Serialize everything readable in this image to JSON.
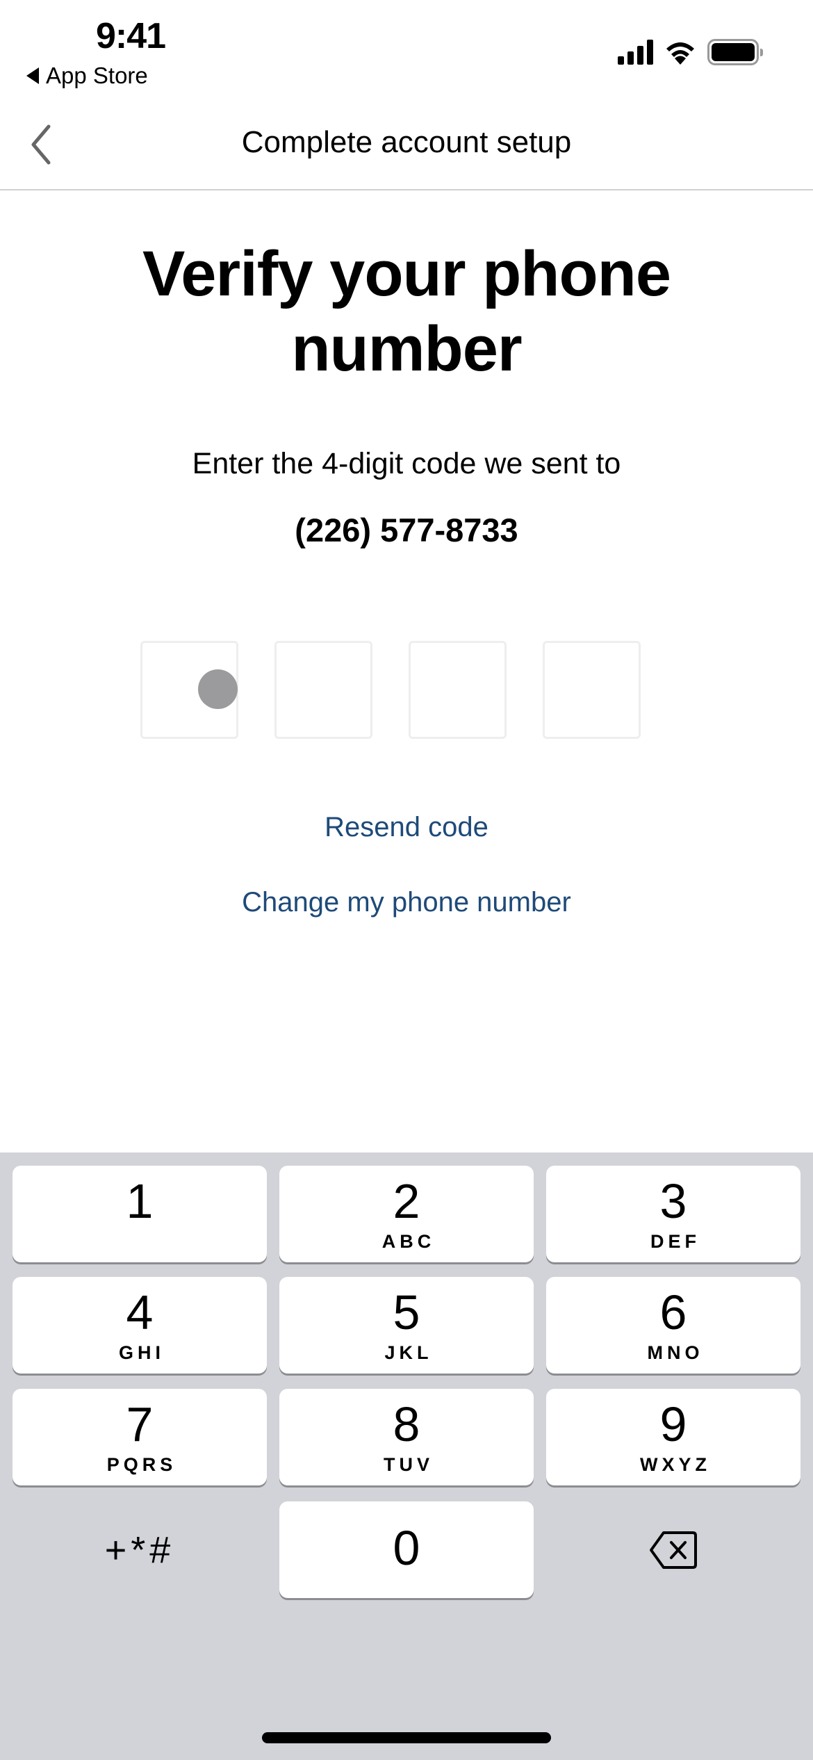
{
  "status_bar": {
    "time": "9:41",
    "back_app": "App Store",
    "icons": [
      "signal-icon",
      "wifi-icon",
      "battery-icon"
    ]
  },
  "nav": {
    "back_icon": "chevron-left-icon",
    "title": "Complete account setup"
  },
  "main": {
    "heading_line1": "Verify your phone",
    "heading_line2": "number",
    "subtitle": "Enter the 4-digit code we sent to",
    "phone": "(226) 577-8733",
    "code_length": 4,
    "code_values": [
      "",
      "",
      "",
      ""
    ],
    "resend_label": "Resend code",
    "change_label": "Change my phone number",
    "link_color": "#1e4a78"
  },
  "keyboard": {
    "keys": [
      {
        "num": "1",
        "letters": ""
      },
      {
        "num": "2",
        "letters": "ABC"
      },
      {
        "num": "3",
        "letters": "DEF"
      },
      {
        "num": "4",
        "letters": "GHI"
      },
      {
        "num": "5",
        "letters": "JKL"
      },
      {
        "num": "6",
        "letters": "MNO"
      },
      {
        "num": "7",
        "letters": "PQRS"
      },
      {
        "num": "8",
        "letters": "TUV"
      },
      {
        "num": "9",
        "letters": "WXYZ"
      },
      {
        "num": "0",
        "letters": ""
      }
    ],
    "symbols_label": "+*#",
    "delete_icon": "backspace-icon"
  }
}
